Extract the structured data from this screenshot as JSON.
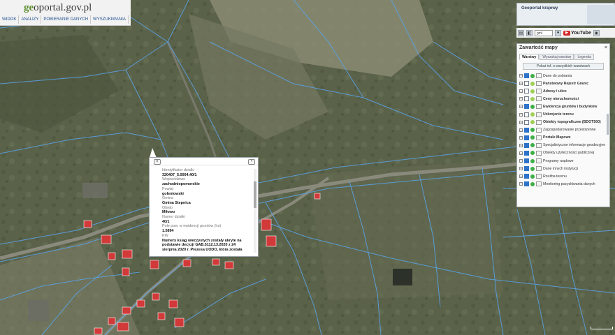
{
  "header": {
    "logo_prefix": "ge",
    "logo_text": "oportal.gov.pl",
    "menu": [
      "WIDOK",
      "ANALIZY",
      "POBIERANIE DANYCH",
      "WYSZUKIWANIA"
    ]
  },
  "minimap": {
    "title": "Geoportal krajowy"
  },
  "toolbar": {
    "zoom_select": "gml",
    "youtube_label": "YouTube"
  },
  "panel": {
    "title": "Zawartość mapy",
    "close": "×",
    "tabs": [
      "Warstwy",
      "Wyszukaj warstwę",
      "Legenda"
    ],
    "active_tab": "Warstwy",
    "all_button": "Pokaż inf. o wszystkich warstwach",
    "layers": [
      {
        "label": "Dane do pobrania",
        "bold": false,
        "checked": true,
        "icon": "folder-icon"
      },
      {
        "label": "Państwowy Rejestr Granic",
        "bold": true,
        "checked": false,
        "icon": "layer-icon"
      },
      {
        "label": "Adresy i ulice",
        "bold": true,
        "checked": false,
        "icon": "layer-icon"
      },
      {
        "label": "Ceny nieruchomości",
        "bold": true,
        "checked": false,
        "icon": "layer-icon"
      },
      {
        "label": "Ewidencja gruntów i budynków",
        "bold": true,
        "checked": true,
        "icon": "layer-icon"
      },
      {
        "label": "Uzbrojenie terenu",
        "bold": true,
        "checked": false,
        "icon": "layer-icon"
      },
      {
        "label": "Obiekty topograficzne (BDOT500)",
        "bold": true,
        "checked": false,
        "icon": "layer-icon"
      },
      {
        "label": "Zagospodarowanie przestrzenne",
        "bold": false,
        "checked": true,
        "icon": "folder-icon"
      },
      {
        "label": "Portale Mapowe",
        "bold": true,
        "checked": true,
        "icon": "layer-icon"
      },
      {
        "label": "Specjalistyczne informacje geodezyjne",
        "bold": false,
        "checked": true,
        "icon": "folder-icon"
      },
      {
        "label": "Obiekty użyteczności publicznej",
        "bold": false,
        "checked": true,
        "icon": "folder-icon"
      },
      {
        "label": "Programy rządowe",
        "bold": false,
        "checked": true,
        "icon": "folder-icon"
      },
      {
        "label": "Dane innych instytucji",
        "bold": false,
        "checked": true,
        "icon": "folder-icon"
      },
      {
        "label": "Rzeźba terenu",
        "bold": false,
        "checked": true,
        "icon": "folder-icon"
      },
      {
        "label": "Monitoring pozyskiwania danych",
        "bold": false,
        "checked": true,
        "icon": "folder-icon"
      }
    ]
  },
  "popup": {
    "rows": [
      {
        "k": "Identyfikator działki",
        "v": "320407_5.0004.40/1"
      },
      {
        "k": "Województwo",
        "v": "zachodniopomorskie"
      },
      {
        "k": "Powiat",
        "v": "goleniowski"
      },
      {
        "k": "Gmina",
        "v": "Gmina Stepnica"
      },
      {
        "k": "Obręb",
        "v": "Miłowo"
      },
      {
        "k": "Numer działki",
        "v": "40/1"
      },
      {
        "k": "Pole pow. w ewidencji gruntów (ha)",
        "v": "1.5894"
      },
      {
        "k": "KW",
        "v": "Numery ksiąg wieczystych zostały ukryte na podstawie decyzji GAB.5112.13.2020 z 24 sierpnia 2020 r. Prezesa UODO, która została"
      }
    ]
  },
  "colors": {
    "parcel_line": "#5aa2e6",
    "building": "#d23a3a"
  }
}
